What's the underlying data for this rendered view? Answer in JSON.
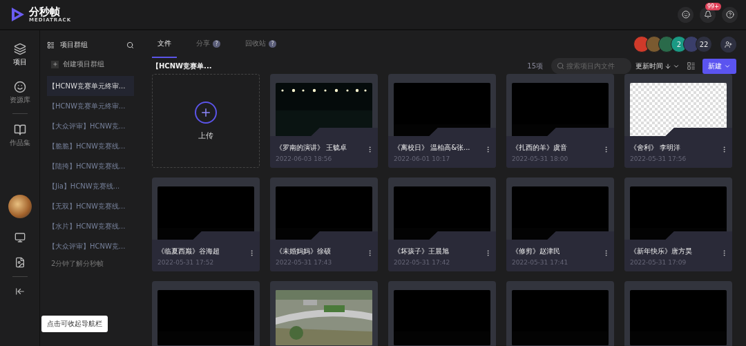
{
  "brand": {
    "name": "分秒帧",
    "sub": "MEDIATRACK"
  },
  "header": {
    "badge": "99+"
  },
  "nav": [
    {
      "label": "项目",
      "selected": true
    },
    {
      "label": "资源库",
      "selected": false
    },
    {
      "label": "作品集",
      "selected": false
    }
  ],
  "nav_tooltip": "点击可收起导航栏",
  "sidebar": {
    "title": "项目群组",
    "create": "创建项目群组",
    "items": [
      {
        "label": "【HCNW竞赛单元终审...",
        "selected": true
      },
      {
        "label": "【HCNW竞赛单元终审...",
        "selected": false
      },
      {
        "label": "【大众评审】HCNW竞...",
        "selected": false
      },
      {
        "label": "【脆脆】HCNW竞赛线...",
        "selected": false
      },
      {
        "label": "【陆挎】HCNW竞赛线...",
        "selected": false
      },
      {
        "label": "【Jia】HCNW竞赛线...",
        "selected": false
      },
      {
        "label": "【无双】HCNW竞赛线...",
        "selected": false
      },
      {
        "label": "【水片】HCNW竞赛线...",
        "selected": false
      },
      {
        "label": "【大众评审】HCNW竞...",
        "selected": false
      }
    ],
    "footer": "2分钟了解分秒帧"
  },
  "tabs": [
    {
      "label": "文件",
      "selected": true
    },
    {
      "label": "分享",
      "badge": "?",
      "selected": false
    },
    {
      "label": "回收站",
      "badge": "?",
      "selected": false
    }
  ],
  "members": {
    "count_a": "2",
    "count_b": "22"
  },
  "breadcrumb": "【HCNW竞赛单...",
  "toolbar": {
    "count": "15项",
    "search_placeholder": "搜索项目内文件",
    "sort": "更新时间",
    "new_button": "新建"
  },
  "upload": {
    "label": "上传"
  },
  "files": [
    {
      "kind": "lights",
      "title": "《罗南的演讲》 王毓卓",
      "date": "2022-06-03 18:56"
    },
    {
      "kind": "blank",
      "title": "《离校日》 温柏高&张...",
      "date": "2022-06-01 10:17"
    },
    {
      "kind": "blank",
      "title": "《扎西的羊》虞音",
      "date": "2022-05-31 18:00"
    },
    {
      "kind": "transparent",
      "title": "《舍利》 李明洋",
      "date": "2022-05-31 17:56"
    },
    {
      "kind": "blank",
      "title": "《临夏西巅》谷海超",
      "date": "2022-05-31 17:52"
    },
    {
      "kind": "blank",
      "title": "《未婚妈妈》徐硕",
      "date": "2022-05-31 17:43"
    },
    {
      "kind": "blank",
      "title": "《坏孩子》王晨旭",
      "date": "2022-05-31 17:42"
    },
    {
      "kind": "blank",
      "title": "《修剪》赵津民",
      "date": "2022-05-31 17:41"
    },
    {
      "kind": "blank",
      "title": "《新年快乐》唐方昊",
      "date": "2022-05-31 17:09"
    },
    {
      "kind": "blank"
    },
    {
      "kind": "aerial"
    },
    {
      "kind": "blank"
    },
    {
      "kind": "blank"
    },
    {
      "kind": "blank"
    }
  ]
}
